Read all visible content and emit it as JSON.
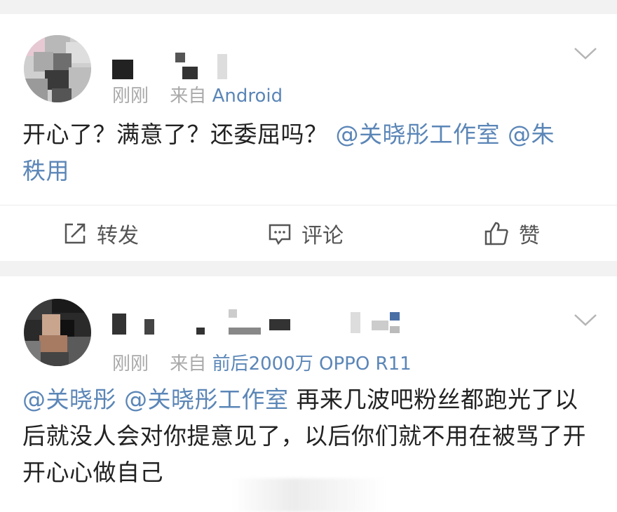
{
  "posts": [
    {
      "time": "刚刚",
      "source_prefix": "来自",
      "source": "Android",
      "content": {
        "text": "开心了？满意了？还委屈吗？",
        "mention1": "@关晓彤工作室",
        "mention2": "@朱",
        "line2": "秩用"
      },
      "actions": {
        "repost": "转发",
        "comment": "评论",
        "like": "赞"
      }
    },
    {
      "time": "刚刚",
      "source_prefix": "来自",
      "source": "前后2000万 OPPO R11",
      "content": {
        "mention1": "@关晓彤",
        "mention2": "@关晓彤工作室",
        "text": "再来几波吧粉丝都跑光了以后就没人会对你提意见了，以后你们就不用在被骂了开开心心做自己"
      }
    }
  ],
  "colors": {
    "link": "#5b86b7",
    "meta": "#a9a9a9",
    "background": "#f2f2f2"
  },
  "icons": [
    "chevron-down-icon",
    "repost-icon",
    "comment-icon",
    "like-icon"
  ]
}
